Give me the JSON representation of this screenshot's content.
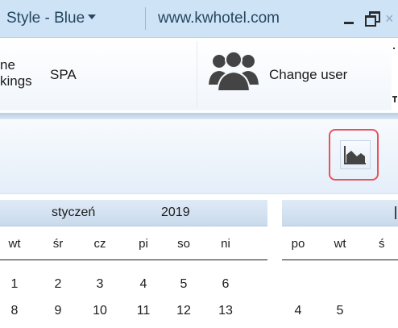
{
  "titlebar": {
    "style_label": "Style - Blue",
    "website": "www.kwhotel.com",
    "close_glyph": "×"
  },
  "ribbon": {
    "partial_line1": "ne",
    "partial_line2": "kings",
    "spa": "SPA",
    "change_user": "Change user"
  },
  "calendar": {
    "month": "styczeń",
    "year": "2019",
    "weekdays_left": [
      "wt",
      "śr",
      "cz",
      "pi",
      "so",
      "ni"
    ],
    "weekdays_right": [
      "po",
      "wt",
      "ś"
    ],
    "week1_left": [
      "1",
      "2",
      "3",
      "4",
      "5",
      "6"
    ],
    "week2_left": [
      "8",
      "9",
      "10",
      "11",
      "12",
      "13"
    ],
    "week2_right": [
      "4",
      "5"
    ]
  },
  "icons": {
    "users": "users-group-icon",
    "chart": "area-chart-icon"
  },
  "colors": {
    "titlebar_bg": "#cfe3f7",
    "highlight_border": "#e8525a",
    "icon_dark": "#444444"
  }
}
